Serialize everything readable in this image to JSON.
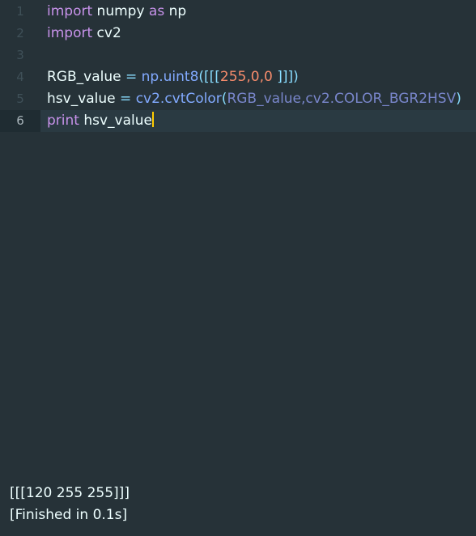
{
  "editor": {
    "lines": [
      {
        "number": "1",
        "tokens": [
          "import",
          " numpy ",
          "as",
          " np"
        ]
      },
      {
        "number": "2",
        "tokens": [
          "import",
          " cv2"
        ]
      },
      {
        "number": "3",
        "tokens": []
      },
      {
        "number": "4",
        "tokens": [
          "RGB_value",
          " = ",
          "np.uint8",
          "([[[",
          "255,0,0",
          " ]]])"
        ]
      },
      {
        "number": "5",
        "tokens": [
          "hsv_value",
          " = ",
          "cv2.cvtColor",
          "(",
          "RGB_value,cv2.COLOR_BGR2HSV",
          ")"
        ]
      },
      {
        "number": "6",
        "tokens": [
          "print",
          " hsv_value"
        ]
      }
    ],
    "current_line": "6"
  },
  "output": {
    "result": "[[[120 255 255]]]",
    "status": "[Finished in 0.1s]"
  },
  "colors": {
    "background": "#263238",
    "keyword": "#c792ea",
    "function": "#82aaff",
    "number": "#f78c6c",
    "cursor": "#ffcc00"
  }
}
